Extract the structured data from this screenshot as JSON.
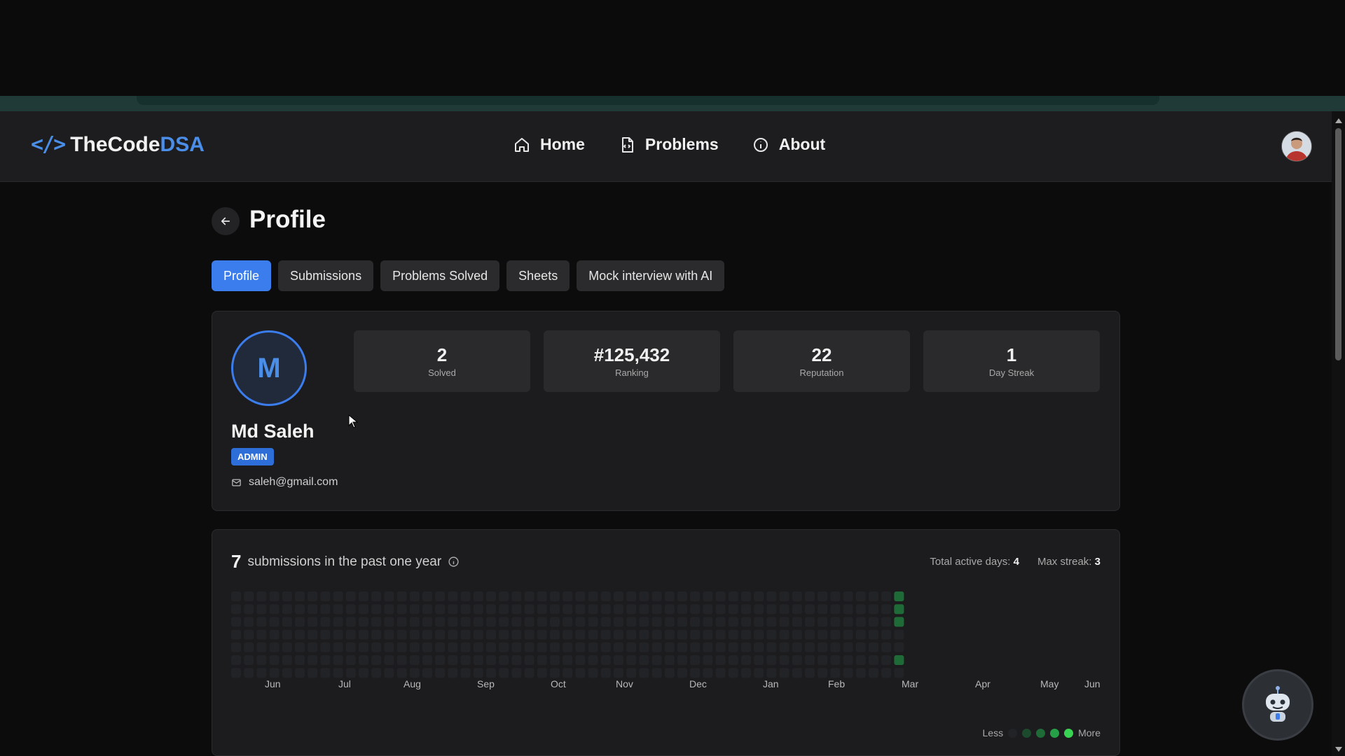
{
  "brand": {
    "name_main": "TheCode",
    "name_accent": "DSA",
    "logo_glyph": "</>",
    "accent_color": "#4a8ee8"
  },
  "nav": {
    "links": [
      {
        "label": "Home",
        "icon": "home-icon"
      },
      {
        "label": "Problems",
        "icon": "file-code-icon"
      },
      {
        "label": "About",
        "icon": "info-icon"
      }
    ]
  },
  "page": {
    "title": "Profile"
  },
  "tabs": [
    {
      "label": "Profile",
      "active": true
    },
    {
      "label": "Submissions",
      "active": false
    },
    {
      "label": "Problems Solved",
      "active": false
    },
    {
      "label": "Sheets",
      "active": false
    },
    {
      "label": "Mock interview with AI",
      "active": false
    }
  ],
  "profile": {
    "initial": "M",
    "name": "Md Saleh",
    "role": "ADMIN",
    "email": "saleh@gmail.com",
    "stats": [
      {
        "value": "2",
        "label": "Solved"
      },
      {
        "value": "#125,432",
        "label": "Ranking"
      },
      {
        "value": "22",
        "label": "Reputation"
      },
      {
        "value": "1",
        "label": "Day Streak"
      }
    ]
  },
  "activity": {
    "count": "7",
    "text": "submissions in the past one year",
    "total_active_label": "Total active days:",
    "total_active_value": "4",
    "max_streak_label": "Max streak:",
    "max_streak_value": "3",
    "months": [
      "Jun",
      "Jul",
      "Aug",
      "Sep",
      "Oct",
      "Nov",
      "Dec",
      "Jan",
      "Feb",
      "Mar",
      "Apr",
      "May",
      "Jun"
    ],
    "legend_less": "Less",
    "legend_more": "More",
    "colors": {
      "empty": "#222326",
      "level1": "#1c4a2c",
      "level2": "#1f6b38",
      "level3": "#26a046",
      "level4": "#39d353"
    },
    "active_days": [
      {
        "week": 52,
        "day": 0,
        "level": 2
      },
      {
        "week": 52,
        "day": 1,
        "level": 2
      },
      {
        "week": 52,
        "day": 2,
        "level": 2
      },
      {
        "week": 52,
        "day": 5,
        "level": 2
      }
    ]
  }
}
